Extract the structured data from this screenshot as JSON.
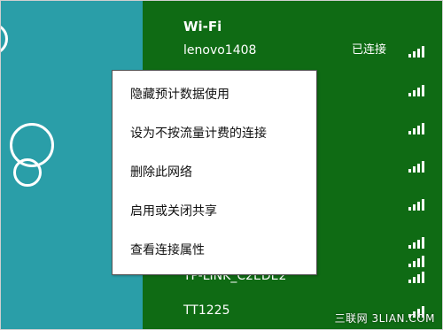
{
  "wifi_panel": {
    "title": "Wi-Fi",
    "networks": [
      {
        "name": "lenovo1408",
        "status": "已连接",
        "signal": 4
      },
      {
        "name": "",
        "status": "",
        "signal": 4
      },
      {
        "name": "",
        "status": "",
        "signal": 4
      },
      {
        "name": "",
        "status": "",
        "signal": 4
      },
      {
        "name": "",
        "status": "",
        "signal": 4
      },
      {
        "name": "",
        "status": "",
        "signal": 4
      },
      {
        "name": "",
        "status": "",
        "signal": 4
      },
      {
        "name": "TP-LINK_C2EDE2",
        "status": "",
        "signal": 4
      },
      {
        "name": "TT1225",
        "status": "",
        "signal": 4
      }
    ]
  },
  "context_menu": {
    "items": [
      "隐藏预计数据使用",
      "设为不按流量计费的连接",
      "删除此网络",
      "启用或关闭共享",
      "查看连接属性"
    ]
  },
  "watermark": {
    "text": "三联网 3LIAN.COM"
  },
  "colors": {
    "desktop_bg": "#2a9ea8",
    "panel_bg": "#0f6b14",
    "menu_bg": "#ffffff"
  }
}
